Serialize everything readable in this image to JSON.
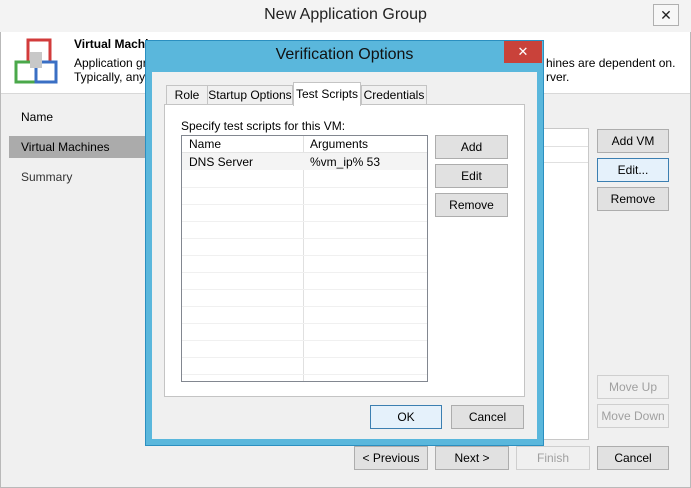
{
  "window": {
    "title": "New Application Group",
    "close_glyph": "✕"
  },
  "header": {
    "title": "Virtual Machines",
    "desc_line1": "Application gro",
    "desc_line2": "Typically, any a",
    "desc_right1": "hines are dependent on.",
    "desc_right2": "rver."
  },
  "nav": {
    "items": [
      {
        "label": "Name"
      },
      {
        "label": "Virtual Machines"
      },
      {
        "label": "Summary"
      }
    ]
  },
  "main_buttons": {
    "add_vm": "Add VM",
    "edit": "Edit...",
    "remove": "Remove",
    "move_up": "Move Up",
    "move_down": "Move Down"
  },
  "footer": {
    "previous": "< Previous",
    "next": "Next >",
    "finish": "Finish",
    "cancel": "Cancel"
  },
  "dialog": {
    "title": "Verification Options",
    "close_glyph": "✕",
    "tabs": [
      "Role",
      "Startup Options",
      "Test Scripts",
      "Credentials"
    ],
    "active_tab": "Test Scripts",
    "instruction": "Specify test scripts for this VM:",
    "columns": [
      "Name",
      "Arguments"
    ],
    "rows": [
      {
        "name": "DNS Server",
        "arguments": "%vm_ip% 53"
      }
    ],
    "buttons": {
      "add": "Add",
      "edit": "Edit",
      "remove": "Remove",
      "ok": "OK",
      "cancel": "Cancel"
    }
  },
  "colors": {
    "dialog_frame": "#5ab7dc",
    "dialog_close": "#c9423a",
    "nav_active": "#ababab"
  }
}
